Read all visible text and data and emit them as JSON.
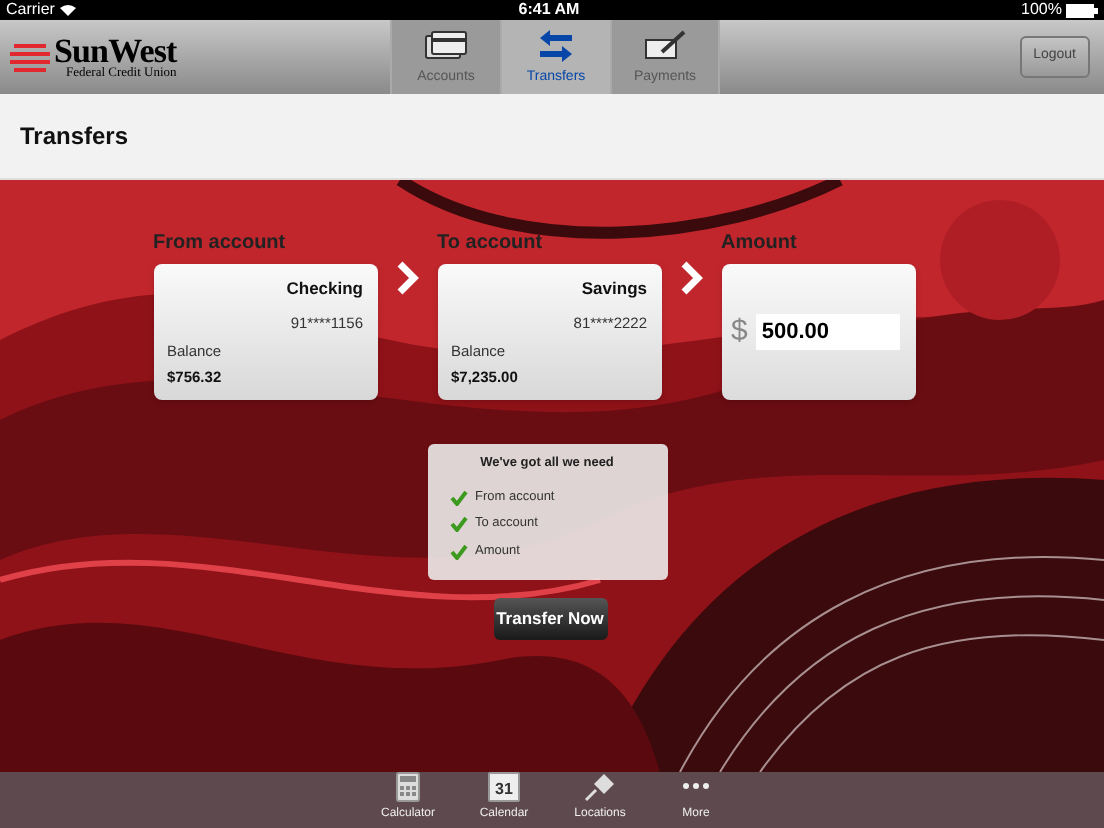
{
  "status_bar": {
    "carrier": "Carrier",
    "time": "6:41 AM",
    "battery": "100%"
  },
  "header": {
    "logo": {
      "name": "SunWest",
      "subtitle": "Federal Credit Union"
    },
    "tabs": [
      {
        "label": "Accounts",
        "kind": "card",
        "selected": false
      },
      {
        "label": "Transfers",
        "kind": "arrows",
        "selected": true
      },
      {
        "label": "Payments",
        "kind": "check",
        "selected": false
      }
    ],
    "logout": "Logout"
  },
  "page_title": "Transfers",
  "from": {
    "heading": "From account",
    "name": "Checking",
    "number": "91****1156",
    "balance_label": "Balance",
    "balance": "$756.32"
  },
  "to": {
    "heading": "To account",
    "name": "Savings",
    "number": "81****2222",
    "balance_label": "Balance",
    "balance": "$7,235.00"
  },
  "amount": {
    "heading": "Amount",
    "currency": "$",
    "value": "500.00"
  },
  "checklist": {
    "title": "We've got all we need",
    "items": [
      {
        "label": "From account",
        "checked": true
      },
      {
        "label": "To account",
        "checked": true
      },
      {
        "label": "Amount",
        "checked": true
      }
    ]
  },
  "transfer_button": "Transfer Now",
  "bottom_bar": [
    {
      "label": "Calculator",
      "kind": "calculator"
    },
    {
      "label": "Calendar",
      "kind": "calendar",
      "day": "31"
    },
    {
      "label": "Locations",
      "kind": "pin"
    },
    {
      "label": "More",
      "kind": "more"
    }
  ]
}
